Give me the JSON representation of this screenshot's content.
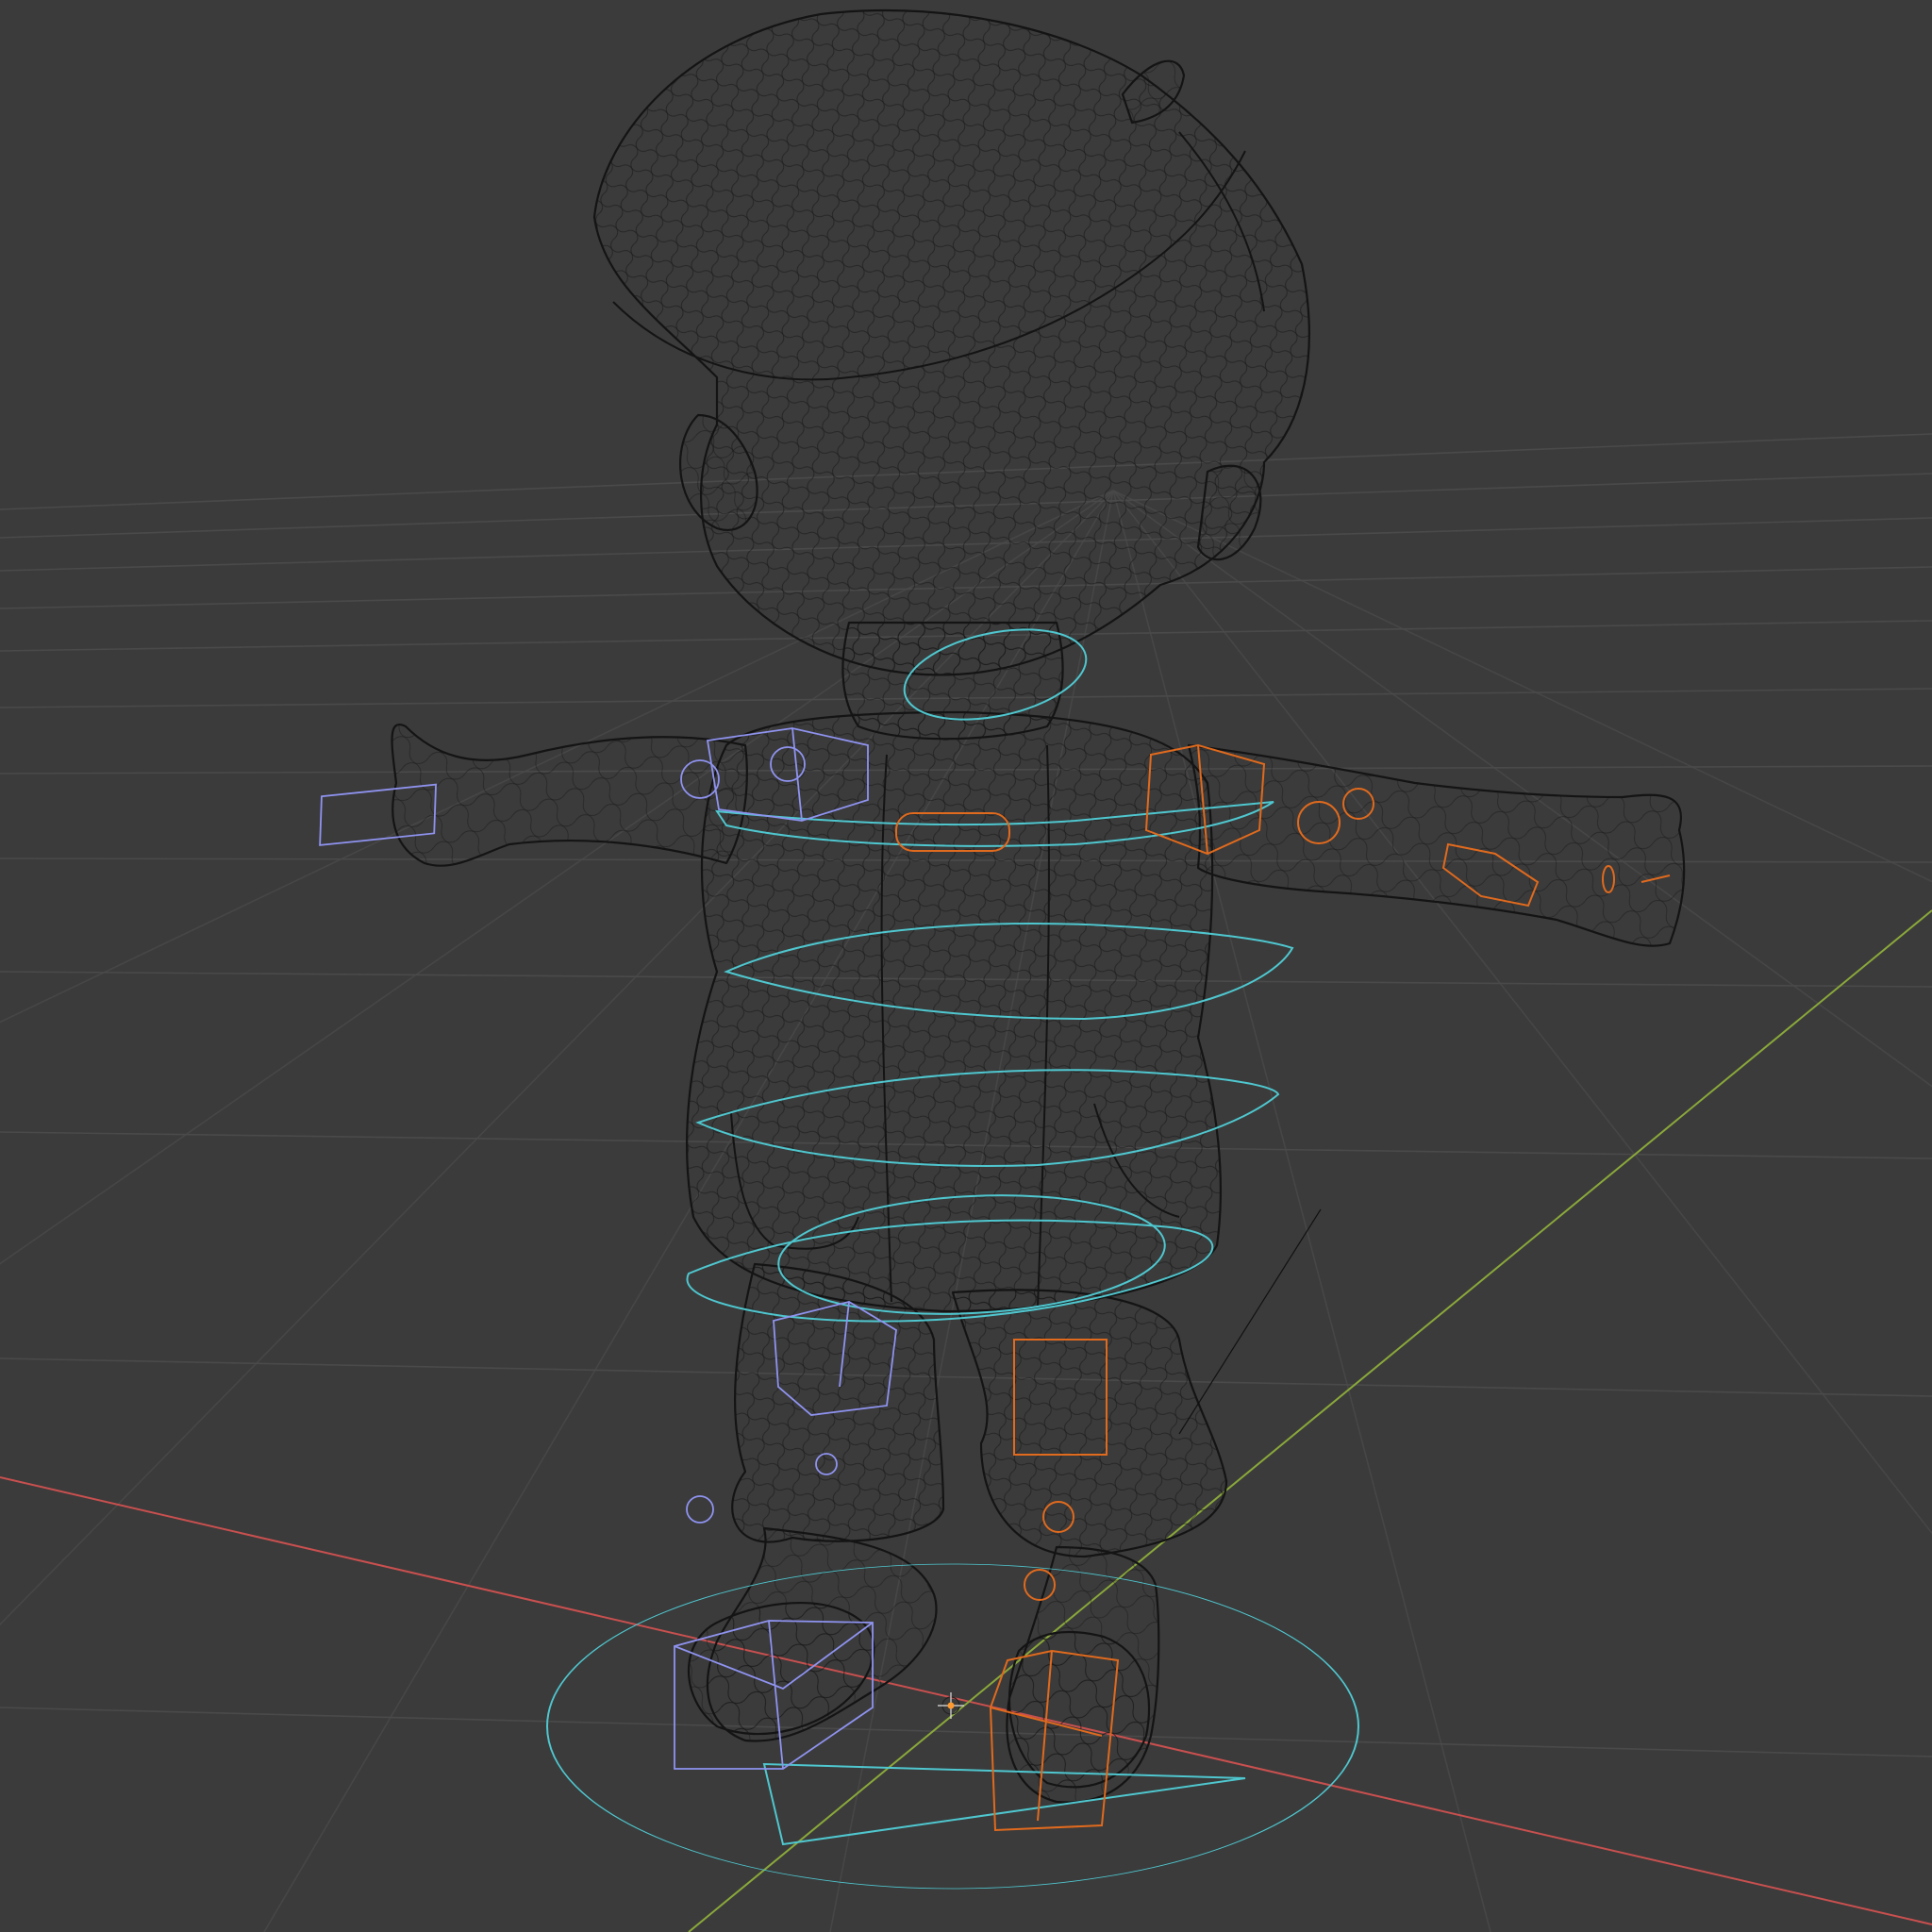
{
  "viewport": {
    "background": "#3b3b3b",
    "grid_color": "#4a4a4a",
    "x_axis_color": "#c9504f",
    "y_axis_color": "#8aa83a",
    "wire_color": "#141414",
    "cyan_controls_color": "#4fc7cf",
    "blue_controls_color": "#8f93f0",
    "orange_controls_color": "#e06a1e",
    "object_origin_color": "#ff9a30"
  },
  "scene": {
    "mesh": "character-wireframe",
    "rig_controls": [
      "cyan-rig-controls",
      "blue-left-side-controls",
      "orange-right-side-controls"
    ],
    "icons": [
      "3d-cursor-icon"
    ]
  }
}
